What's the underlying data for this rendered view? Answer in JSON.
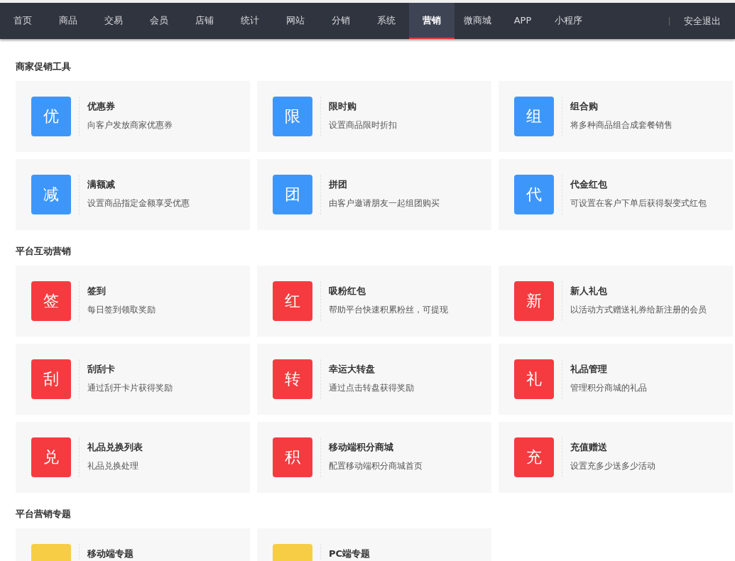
{
  "nav": {
    "items": [
      {
        "label": "首页",
        "selected": false
      },
      {
        "label": "商品",
        "selected": false
      },
      {
        "label": "交易",
        "selected": false
      },
      {
        "label": "会员",
        "selected": false
      },
      {
        "label": "店铺",
        "selected": false
      },
      {
        "label": "统计",
        "selected": false
      },
      {
        "label": "网站",
        "selected": false
      },
      {
        "label": "分销",
        "selected": false
      },
      {
        "label": "系统",
        "selected": false
      },
      {
        "label": "营销",
        "selected": true
      },
      {
        "label": "微商城",
        "selected": false
      },
      {
        "label": "APP",
        "selected": false
      },
      {
        "label": "小程序",
        "selected": false
      }
    ],
    "logout": "安全退出"
  },
  "sections": [
    {
      "title": "商家促销工具",
      "color": "#3d97fb",
      "tools": [
        {
          "icon": "优",
          "name": "优惠券",
          "desc": "向客户发放商家优惠券"
        },
        {
          "icon": "限",
          "name": "限时购",
          "desc": "设置商品限时折扣"
        },
        {
          "icon": "组",
          "name": "组合购",
          "desc": "将多种商品组合成套餐销售"
        },
        {
          "icon": "减",
          "name": "满额减",
          "desc": "设置商品指定金额享受优惠"
        },
        {
          "icon": "团",
          "name": "拼团",
          "desc": "由客户邀请朋友一起组团购买"
        },
        {
          "icon": "代",
          "name": "代金红包",
          "desc": "可设置在客户下单后获得裂变式红包"
        }
      ]
    },
    {
      "title": "平台互动营销",
      "color": "#f53b40",
      "tools": [
        {
          "icon": "签",
          "name": "签到",
          "desc": "每日签到领取奖励"
        },
        {
          "icon": "红",
          "name": "吸粉红包",
          "desc": "帮助平台快速积累粉丝，可提现"
        },
        {
          "icon": "新",
          "name": "新人礼包",
          "desc": "以活动方式赠送礼券给新注册的会员"
        },
        {
          "icon": "刮",
          "name": "刮刮卡",
          "desc": "通过刮开卡片获得奖励"
        },
        {
          "icon": "转",
          "name": "幸运大转盘",
          "desc": "通过点击转盘获得奖励"
        },
        {
          "icon": "礼",
          "name": "礼品管理",
          "desc": "管理积分商城的礼品"
        },
        {
          "icon": "兑",
          "name": "礼品兑换列表",
          "desc": "礼品兑换处理"
        },
        {
          "icon": "积",
          "name": "移动端积分商城",
          "desc": "配置移动端积分商城首页"
        },
        {
          "icon": "充",
          "name": "充值赠送",
          "desc": "设置充多少送多少活动"
        }
      ]
    },
    {
      "title": "平台营销专题",
      "color": "#f7cd45",
      "tools": [
        {
          "name": "移动端专题"
        },
        {
          "name": "PC端专题"
        }
      ]
    }
  ]
}
